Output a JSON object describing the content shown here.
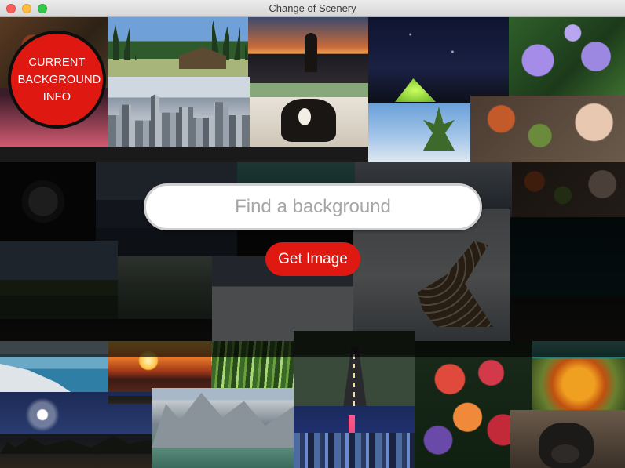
{
  "window": {
    "title": "Change of Scenery"
  },
  "info_badge": {
    "label": "CURRENT BACKGROUND INFO"
  },
  "search": {
    "placeholder": "Find a background",
    "value": ""
  },
  "get_image_button": {
    "label": "Get Image"
  },
  "colors": {
    "accent_red": "#e01812",
    "dim_overlay": "#000000"
  },
  "icons": [
    "close-icon",
    "minimize-icon",
    "maximize-icon"
  ],
  "background_tiles": [
    "food-platter",
    "forest-cabin",
    "beach-silhouette",
    "night-tent",
    "purple-lotus",
    "city-skyline",
    "dog-on-beach",
    "pineapple",
    "food-table",
    "dark-rose",
    "castle",
    "misty-mountains",
    "giraffe",
    "snow-path",
    "icelandic-coast",
    "sunset-rocks",
    "bamboo-forest",
    "desert-road",
    "red-flowers",
    "moonlit-night",
    "mountain-lake",
    "shanghai-night",
    "autumn-leaves",
    "gorilla"
  ]
}
